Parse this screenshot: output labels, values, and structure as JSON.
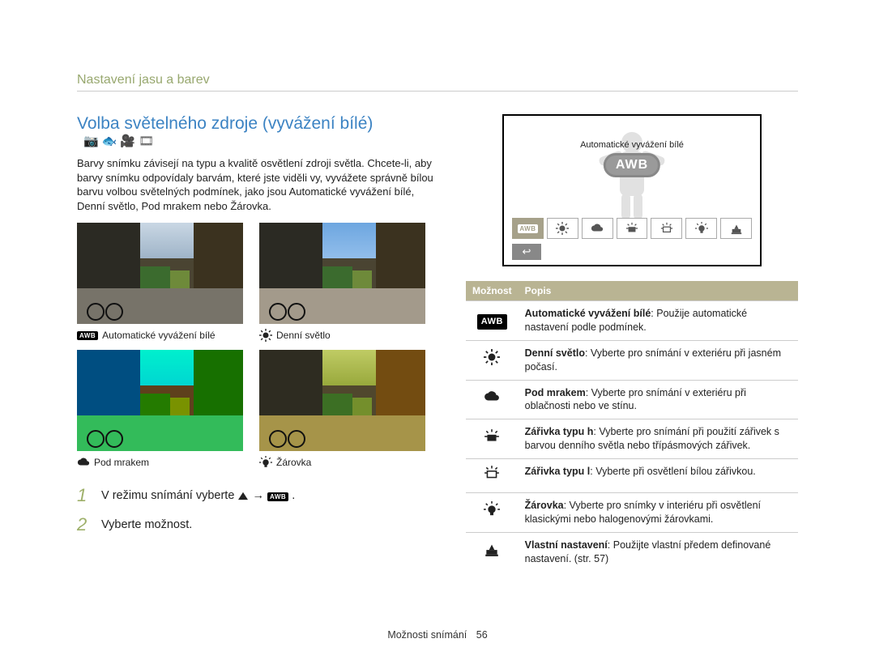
{
  "breadcrumb": "Nastavení jasu a barev",
  "section_title": "Volba světelného zdroje (vyvážení bílé)",
  "intro": "Barvy snímku závisejí na typu a kvalitě osvětlení zdroji světla. Chcete-li, aby barvy snímku odpovídaly barvám, které jste viděli vy, vyvážete správně bílou barvu volbou světelných podmínek, jako jsou Automatické vyvážení bílé, Denní světlo, Pod mrakem nebo Žárovka.",
  "mode_icons": [
    "camera-icon",
    "fish-icon",
    "video-icon",
    "smart-icon"
  ],
  "captions": {
    "awb": "Automatické vyvážení bílé",
    "daylight": "Denní světlo",
    "cloudy": "Pod mrakem",
    "tungsten": "Žárovka"
  },
  "steps": {
    "1": {
      "pre": "V režimu snímání vyberte ",
      "post": "."
    },
    "2": "Vyberte možnost."
  },
  "wb_screen": {
    "tooltip": "Automatické vyvážení bílé",
    "awb_label": "AWB",
    "back": "↩",
    "options": [
      "awb",
      "sun",
      "cloud",
      "fl-h",
      "fl-l",
      "bulb",
      "custom"
    ]
  },
  "table": {
    "headers": {
      "option": "Možnost",
      "desc": "Popis"
    },
    "rows": [
      {
        "icon": "awb",
        "title": "Automatické vyvážení bílé",
        "body": ": Použije automatické nastavení podle podmínek."
      },
      {
        "icon": "sun",
        "title": "Denní světlo",
        "body": ": Vyberte pro snímání v exteriéru při jasném počasí."
      },
      {
        "icon": "cloud",
        "title": "Pod mrakem",
        "body": ": Vyberte pro snímání v exteriéru při oblačnosti nebo ve stínu."
      },
      {
        "icon": "fl-h",
        "title": "Zářivka typu h",
        "body": ": Vyberte pro snímání při použití zářivek s barvou denního světla nebo třípásmových zářivek."
      },
      {
        "icon": "fl-l",
        "title": "Zářivka typu l",
        "body": ": Vyberte při osvětlení bílou zářivkou."
      },
      {
        "icon": "bulb",
        "title": "Žárovka",
        "body": ": Vyberte pro snímky v interiéru při osvětlení klasickými nebo halogenovými žárovkami."
      },
      {
        "icon": "custom",
        "title": "Vlastní nastavení",
        "body": ": Použijte vlastní předem definované nastavení. (str. 57)"
      }
    ]
  },
  "footer": {
    "section": "Možnosti snímání",
    "page": "56"
  }
}
